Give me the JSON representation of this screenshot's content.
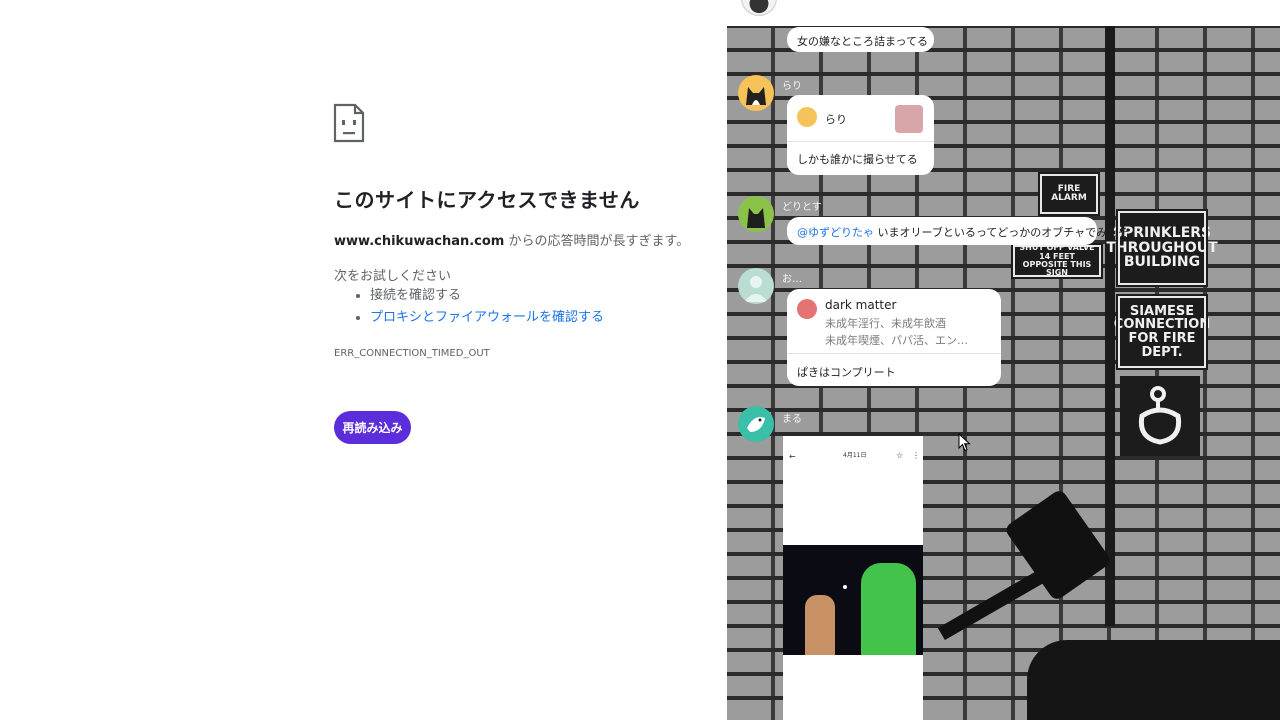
{
  "error": {
    "title": "このサイトにアクセスできません",
    "host": "www.chikuwachan.com",
    "desc_suffix": " からの応答時間が長すぎます。",
    "try_label": "次をお試しください",
    "suggestions": [
      "接続を確認する",
      "プロキシとファイアウォールを確認する"
    ],
    "code": "ERR_CONNECTION_TIMED_OUT",
    "reload_label": "再読み込み"
  },
  "chat": {
    "messages": [
      {
        "text": "女の嫌なところ詰まってる"
      },
      {
        "user": "らり",
        "quote_name": "らり",
        "text": "しかも誰かに撮らせてる"
      },
      {
        "user": "どりとす",
        "mention": "@ゆずどりたゃ",
        "text": " いまオリーブといるってどっかのオブチャでみたぞ"
      },
      {
        "user": "お…",
        "quote_name": "dark matter",
        "quote_line1": "未成年淫行、未成年飲酒",
        "quote_line2": "未成年喫煙、パパ活、エン…",
        "text": "ぱきはコンプリート"
      },
      {
        "user": "まる",
        "shot_date": "4月11日"
      }
    ]
  },
  "signs": {
    "sprinklers": [
      "SPRINKLERS",
      "THROUGHOUT",
      "BUILDING"
    ],
    "siamese": [
      "SIAMESE",
      "CONNECTION",
      "FOR FIRE DEPT."
    ],
    "fire_alarm": "FIRE ALARM",
    "shutoff": [
      "SHUT OFF VALVE",
      "14 FEET",
      "OPPOSITE THIS SIGN"
    ]
  },
  "colors": {
    "accent": "#5b2ddb",
    "link": "#1a73e8"
  }
}
